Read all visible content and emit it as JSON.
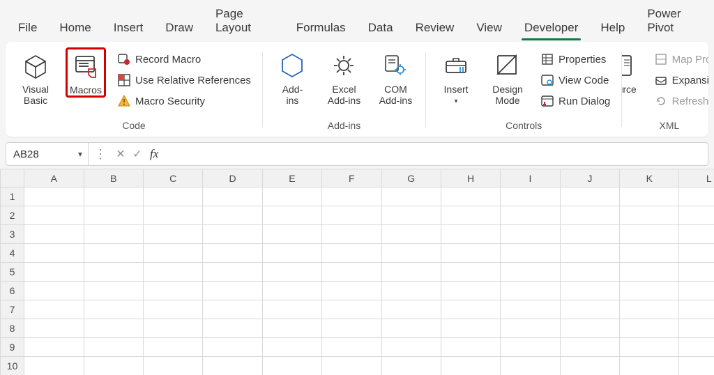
{
  "tabs": {
    "items": [
      "File",
      "Home",
      "Insert",
      "Draw",
      "Page Layout",
      "Formulas",
      "Data",
      "Review",
      "View",
      "Developer",
      "Help",
      "Power Pivot"
    ],
    "active_index": 9
  },
  "ribbon": {
    "groups": {
      "code": {
        "label": "Code",
        "visual_basic": "Visual Basic",
        "macros": "Macros",
        "record_macro": "Record Macro",
        "use_relative": "Use Relative References",
        "macro_security": "Macro Security"
      },
      "addins": {
        "label": "Add-ins",
        "addins": "Add-\nins",
        "excel_addins": "Excel\nAdd-ins",
        "com_addins": "COM\nAdd-ins"
      },
      "controls": {
        "label": "Controls",
        "insert": "Insert",
        "design_mode": "Design\nMode",
        "properties": "Properties",
        "view_code": "View Code",
        "run_dialog": "Run Dialog"
      },
      "xml": {
        "label": "XML",
        "source": "Source",
        "map_properties": "Map Properti",
        "expansion_packs": "Expansion Pa",
        "refresh_data": "Refresh Data"
      }
    }
  },
  "formula_bar": {
    "name_box": "AB28",
    "fx": "fx",
    "value": ""
  },
  "grid": {
    "columns": [
      "A",
      "B",
      "C",
      "D",
      "E",
      "F",
      "G",
      "H",
      "I",
      "J",
      "K",
      "L"
    ],
    "rows": [
      "1",
      "2",
      "3",
      "4",
      "5",
      "6",
      "7",
      "8",
      "9",
      "10"
    ]
  }
}
